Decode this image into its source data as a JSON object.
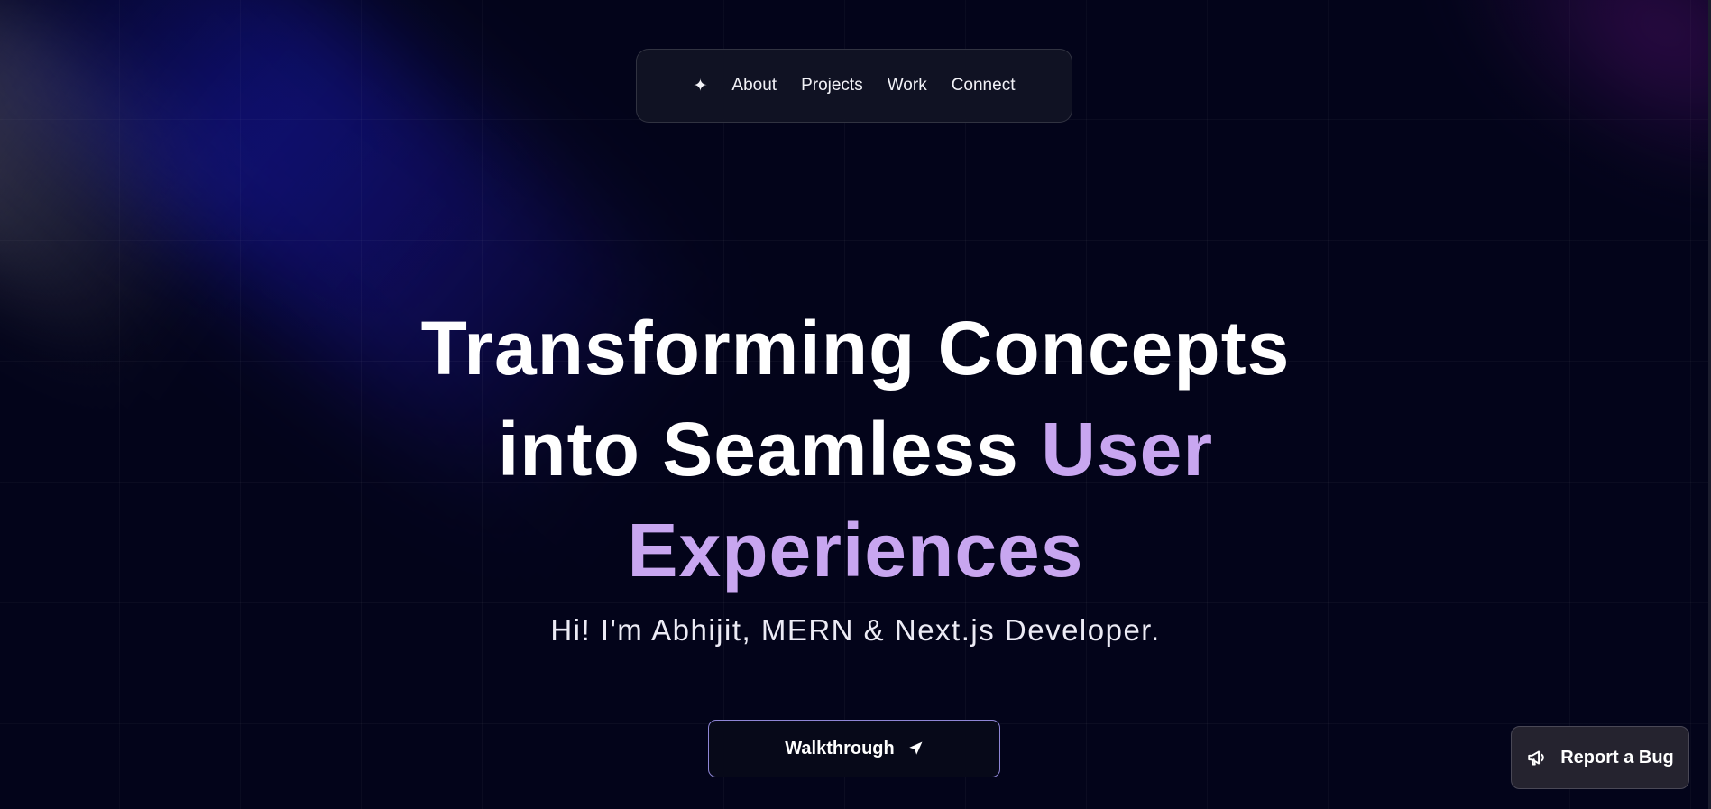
{
  "nav": {
    "logo_icon": "sparkle-icon",
    "logo_glyph": "✦",
    "items": [
      {
        "label": "About"
      },
      {
        "label": "Projects"
      },
      {
        "label": "Work"
      },
      {
        "label": "Connect"
      }
    ]
  },
  "hero": {
    "line1": "Transforming Concepts",
    "line2_plain": "into Seamless ",
    "line2_accent": "User",
    "line3_accent": "Experiences",
    "accent_color": "#c8a6f0",
    "subtitle": "Hi! I'm Abhijit, MERN & Next.js Developer."
  },
  "cta": {
    "label": "Walkthrough",
    "icon": "send-arrow-icon",
    "border_color": "#8f86d6"
  },
  "report_bug": {
    "label": "Report a Bug",
    "icon": "megaphone-icon"
  },
  "colors": {
    "background": "#03041a",
    "beam_blue": "#1919be",
    "beam_purple": "#6e148c"
  }
}
